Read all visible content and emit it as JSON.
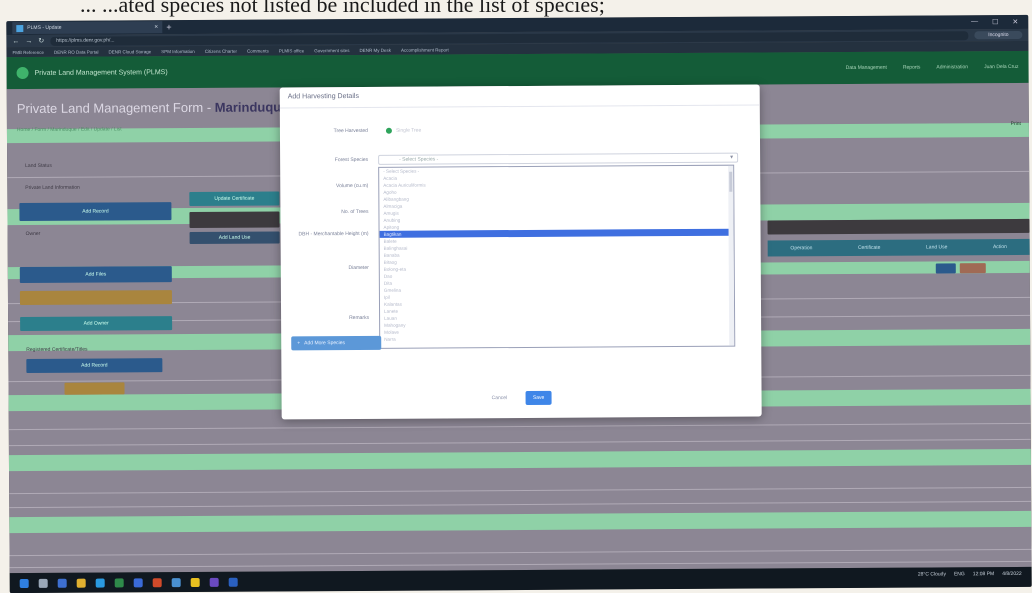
{
  "paper": {
    "text": "... ...ated species not listed be included in the list of species;"
  },
  "browser": {
    "tab_title": "PLMS - Update",
    "url": "https://plms.denr.gov.ph/...",
    "profile": "Incognito",
    "bookmarks": [
      "FMB Reference",
      "DENR RO Data Portal",
      "DENR Cloud Storage",
      "SPM Information",
      "Citizens Charter",
      "Comments",
      "PLMIS office",
      "Government sites",
      "DENR My Desk",
      "Accomplishment Report"
    ]
  },
  "app": {
    "title": "Private Land Management System (PLMS)",
    "user_nav": [
      "Data Management",
      "Reports",
      "Administration",
      "Juan Dela Cruz"
    ]
  },
  "page": {
    "title_prefix": "Private Land Management Form - ",
    "title_bold": "Marinduque",
    "breadcrumb": "Home / Form / Marinduque / Edit / Update / List",
    "print": "Print",
    "left_labels": [
      "Land Status",
      "Private Land Information",
      "Owner",
      "Registered Certificate/Titles"
    ],
    "buttons": [
      "Add Record",
      "Update Certificate",
      "Add Land Use",
      "Add Files",
      "Add Owner",
      "Add Record"
    ],
    "table_header": [
      "Operation",
      "Certificate",
      "Land Use",
      "Action"
    ]
  },
  "modal": {
    "title": "Add Harvesting Details",
    "labels": {
      "type": "Tree Harvested",
      "species": "Forest Species",
      "volume": "Volume (cu.m)",
      "trees": "No. of Trees",
      "dbh": "DBH - Merchantable Height (m)",
      "diameter": "Diameter",
      "remarks": "Remarks"
    },
    "radio_option": "Single Tree",
    "select_placeholder": "- Select Species -",
    "options": [
      "- Select Species -",
      "Acacia",
      "Acacia Auriculiformis",
      "Agoho",
      "Alibangbang",
      "Almaciga",
      "Amugis",
      "Anubing",
      "Apitong",
      "Bagtikan",
      "Balete",
      "Balinghasai",
      "Banaba",
      "Bitaog",
      "Bolong-eta",
      "Dao",
      "Dita",
      "Gmelina",
      "Ipil",
      "Kalantas",
      "Lanete",
      "Lauan",
      "Mahogany",
      "Molave",
      "Narra"
    ],
    "selected_index": 9,
    "add_more": "Add More Species",
    "cancel": "Cancel",
    "save": "Save"
  },
  "taskbar": {
    "weather": "28°C Cloudy",
    "lang": "ENG",
    "time": "12:08 PM",
    "date": "4/8/2022"
  }
}
